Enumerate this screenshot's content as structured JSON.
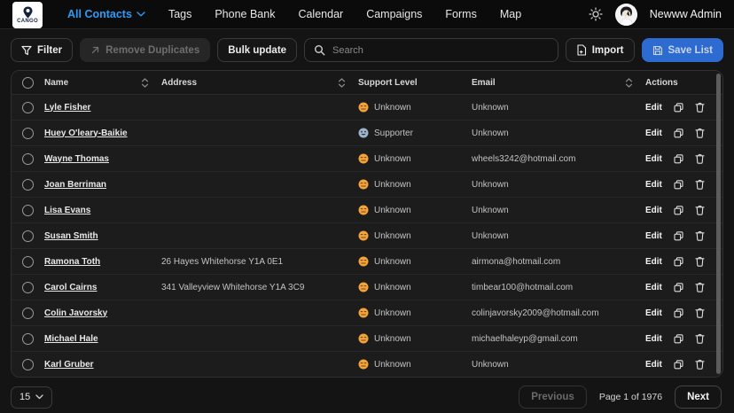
{
  "colors": {
    "accent_blue": "#2e9bf6",
    "save_button_blue": "#2e6bd0",
    "unknown_badge_orange": "#f2a33c",
    "supporter_badge_blue": "#9db3c9"
  },
  "navbar": {
    "logo_text": "CANGO",
    "items": [
      {
        "label": "All Contacts",
        "active": true,
        "dropdown": true
      },
      {
        "label": "Tags",
        "active": false,
        "dropdown": false
      },
      {
        "label": "Phone Bank",
        "active": false,
        "dropdown": false
      },
      {
        "label": "Calendar",
        "active": false,
        "dropdown": false
      },
      {
        "label": "Campaigns",
        "active": false,
        "dropdown": false
      },
      {
        "label": "Forms",
        "active": false,
        "dropdown": false
      },
      {
        "label": "Map",
        "active": false,
        "dropdown": false
      }
    ],
    "user_name": "Newww Admin"
  },
  "toolbar": {
    "filter_label": "Filter",
    "remove_duplicates_label": "Remove Duplicates",
    "bulk_update_label": "Bulk update",
    "search_placeholder": "Search",
    "import_label": "Import",
    "save_list_label": "Save List"
  },
  "table": {
    "columns": [
      {
        "label": "Name",
        "sortable": true
      },
      {
        "label": "Address",
        "sortable": true
      },
      {
        "label": "Support Level",
        "sortable": false
      },
      {
        "label": "Email",
        "sortable": true
      },
      {
        "label": "Actions",
        "sortable": false
      }
    ],
    "edit_label": "Edit",
    "rows": [
      {
        "name": "Lyle Fisher",
        "address": "",
        "support_level": "Unknown",
        "email": "Unknown"
      },
      {
        "name": "Huey O'leary-Baikie",
        "address": "",
        "support_level": "Supporter",
        "email": "Unknown"
      },
      {
        "name": "Wayne Thomas",
        "address": "",
        "support_level": "Unknown",
        "email": "wheels3242@hotmail.com"
      },
      {
        "name": "Joan Berriman",
        "address": "",
        "support_level": "Unknown",
        "email": "Unknown"
      },
      {
        "name": "Lisa Evans",
        "address": "",
        "support_level": "Unknown",
        "email": "Unknown"
      },
      {
        "name": "Susan Smith",
        "address": "",
        "support_level": "Unknown",
        "email": "Unknown"
      },
      {
        "name": "Ramona Toth",
        "address": "26 Hayes Whitehorse Y1A 0E1",
        "support_level": "Unknown",
        "email": "airmona@hotmail.com"
      },
      {
        "name": "Carol Cairns",
        "address": "341 Valleyview Whitehorse Y1A 3C9",
        "support_level": "Unknown",
        "email": "timbear100@hotmail.com"
      },
      {
        "name": "Colin Javorsky",
        "address": "",
        "support_level": "Unknown",
        "email": "colinjavorsky2009@hotmail.com"
      },
      {
        "name": "Michael Hale",
        "address": "",
        "support_level": "Unknown",
        "email": "michaelhaleyp@gmail.com"
      },
      {
        "name": "Karl Gruber",
        "address": "",
        "support_level": "Unknown",
        "email": "Unknown"
      }
    ]
  },
  "pagination": {
    "page_size": "15",
    "previous_label": "Previous",
    "page_info": "Page 1 of 1976",
    "next_label": "Next"
  }
}
